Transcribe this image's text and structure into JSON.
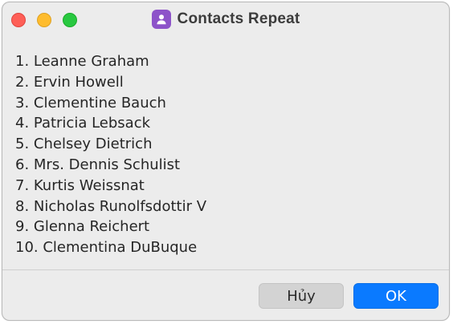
{
  "window": {
    "title": "Contacts Repeat",
    "app_icon": "contacts-icon"
  },
  "contacts": [
    "1. Leanne Graham",
    "2. Ervin Howell",
    "3. Clementine Bauch",
    "4. Patricia Lebsack",
    "5. Chelsey Dietrich",
    "6. Mrs. Dennis Schulist",
    "7. Kurtis Weissnat",
    "8. Nicholas Runolfsdottir V",
    "9. Glenna Reichert",
    "10. Clementina DuBuque"
  ],
  "buttons": {
    "cancel_label": "Hủy",
    "ok_label": "OK"
  },
  "colors": {
    "accent": "#0a7aff",
    "app_icon": "#8d53c9",
    "close": "#fe5f57",
    "minimize": "#febc2e",
    "zoom": "#28c840"
  }
}
